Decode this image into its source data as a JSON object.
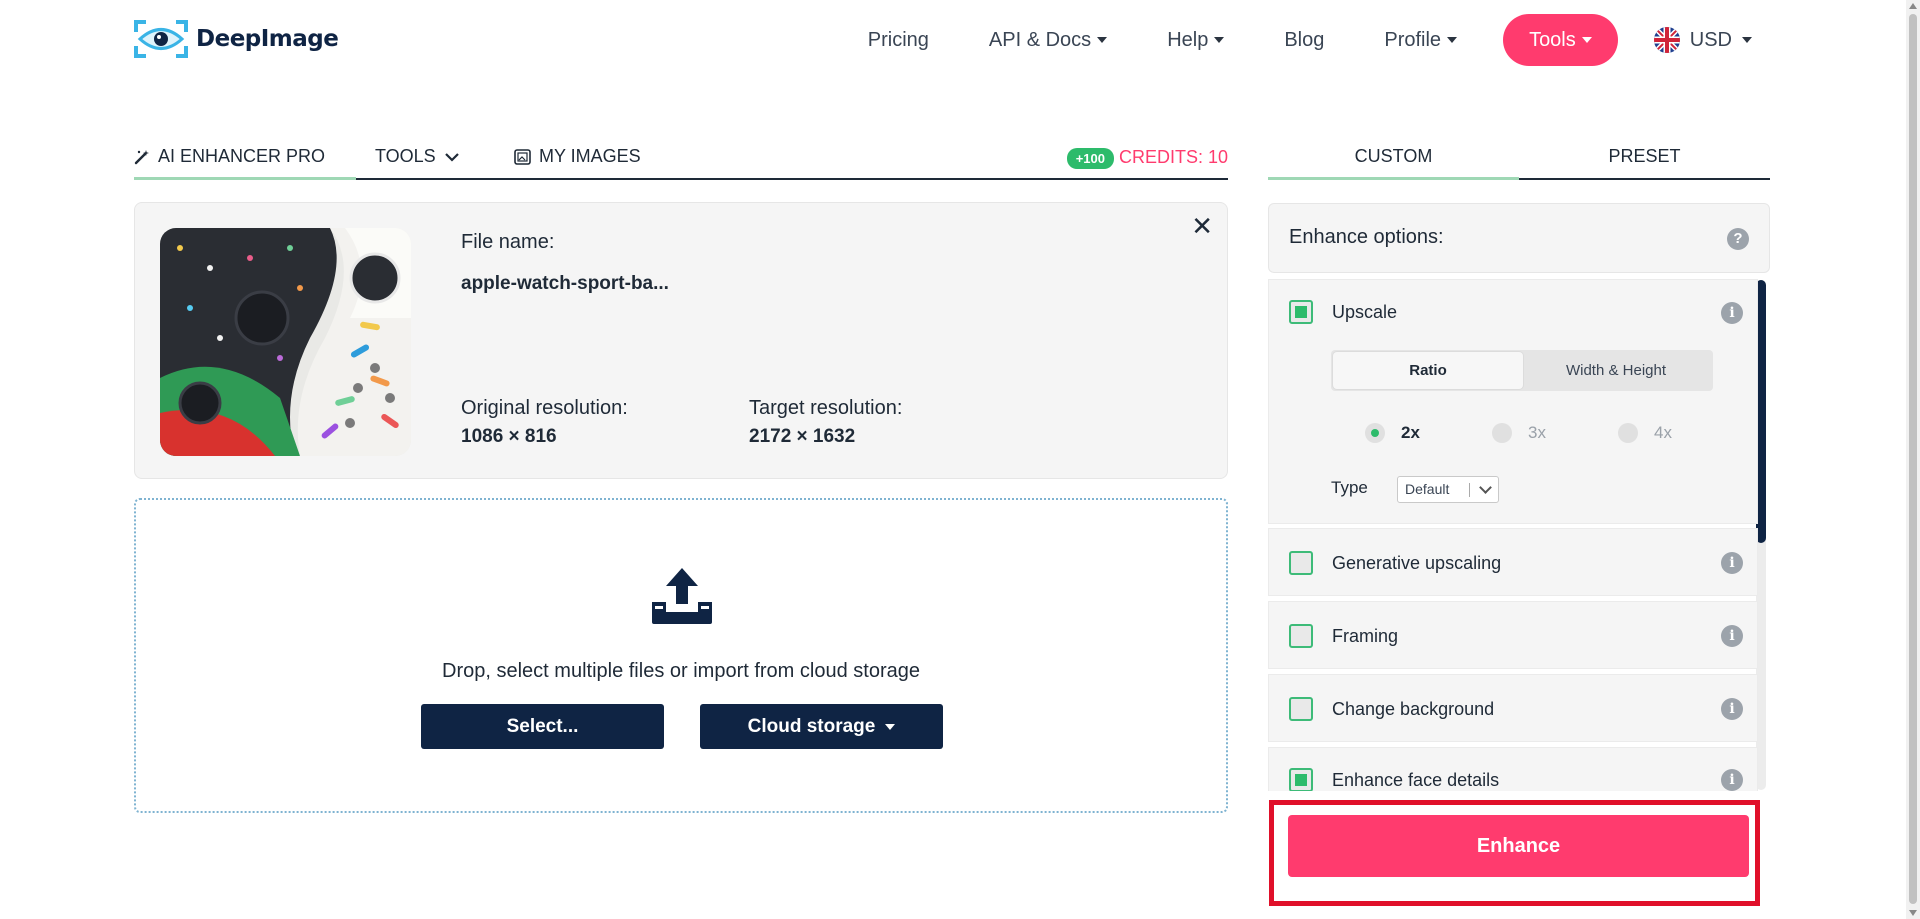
{
  "brand": {
    "name": "DeepImage"
  },
  "nav": {
    "items": [
      {
        "label": "Pricing",
        "dropdown": false
      },
      {
        "label": "API & Docs",
        "dropdown": true
      },
      {
        "label": "Help",
        "dropdown": true
      },
      {
        "label": "Blog",
        "dropdown": false
      },
      {
        "label": "Profile",
        "dropdown": true
      }
    ],
    "tools_label": "Tools",
    "currency_label": "USD"
  },
  "tabs": {
    "enhancer": "AI ENHANCER PRO",
    "tools": "TOOLS",
    "my_images": "MY IMAGES",
    "credit_badge": "+100",
    "credits": "CREDITS: 10"
  },
  "file": {
    "name_label": "File name:",
    "name_value": "apple-watch-sport-ba...",
    "original_label": "Original resolution:",
    "original_value": "1086 × 816",
    "target_label": "Target resolution:",
    "target_value": "2172 × 1632"
  },
  "upload": {
    "text": "Drop, select multiple files or import from cloud storage",
    "select_label": "Select...",
    "cloud_label": "Cloud storage"
  },
  "right_tabs": {
    "custom": "CUSTOM",
    "preset": "PRESET"
  },
  "options": {
    "title": "Enhance options:",
    "help": "?",
    "upscale": {
      "label": "Upscale",
      "checked": true,
      "mode_ratio": "Ratio",
      "mode_wh": "Width & Height",
      "ratios": [
        "2x",
        "3x",
        "4x"
      ],
      "selected_ratio": "2x",
      "type_label": "Type",
      "type_value": "Default"
    },
    "items": [
      {
        "label": "Generative upscaling",
        "checked": false
      },
      {
        "label": "Framing",
        "checked": false
      },
      {
        "label": "Change background",
        "checked": false
      },
      {
        "label": "Enhance face details",
        "checked": true
      }
    ],
    "info": "i"
  },
  "enhance_label": "Enhance",
  "colors": {
    "accent": "#ff3b6e",
    "navy": "#0f2444",
    "green": "#2dbb6b",
    "highlight": "#e0102a"
  }
}
